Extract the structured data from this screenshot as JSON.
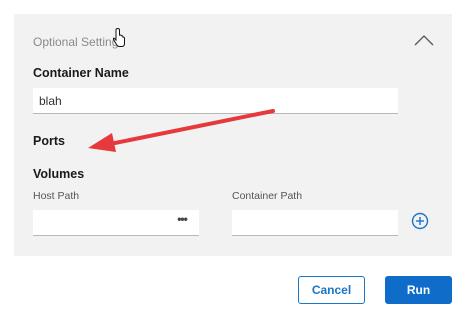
{
  "panel": {
    "header_title": "Optional Settings",
    "collapse_icon": "chevron-up-icon"
  },
  "container_name": {
    "label": "Container Name",
    "value": "blah"
  },
  "ports": {
    "label": "Ports"
  },
  "volumes": {
    "label": "Volumes",
    "host_path_label": "Host Path",
    "host_path_value": "",
    "container_path_label": "Container Path",
    "container_path_value": "",
    "more_icon": "more-horizontal-icon",
    "add_icon": "plus-circle-icon"
  },
  "annotation": {
    "arrow_color": "#e5393b"
  },
  "actions": {
    "cancel_label": "Cancel",
    "run_label": "Run"
  },
  "colors": {
    "accent": "#0f6cc9",
    "panel_bg": "#f2f2f2"
  }
}
